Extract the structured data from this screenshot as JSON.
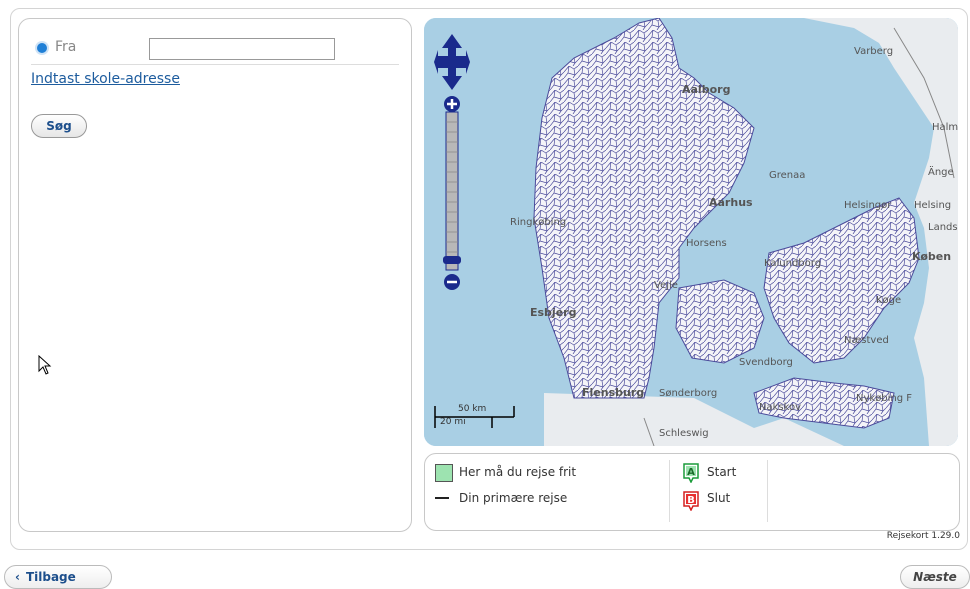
{
  "form": {
    "from_label": "Fra",
    "from_value": "",
    "school_link": "Indtast skole-adresse",
    "search_button": "Søg"
  },
  "map": {
    "labels": {
      "varberg": "Varberg",
      "aalborg": "Aalborg",
      "halmstad": "Halm",
      "grenaa": "Grenaa",
      "angelholm": "Änge",
      "aarhus": "Aarhus",
      "helsingor": "Helsingør",
      "helsingborg": "Helsing",
      "landskrona": "Lands",
      "ringkobing": "Ringkøbing",
      "horsens": "Horsens",
      "kalundborg": "Kalundborg",
      "kobenhavn": "Køben",
      "koge": "Køge",
      "esbjerg": "Esbjerg",
      "vejle": "Vejle",
      "naestved": "Næstved",
      "svendborg": "Svendborg",
      "flensburg": "Flensburg",
      "sonderborg": "Sønderborg",
      "nakskov": "Nakskov",
      "nykobing": "Nykøbing F",
      "schleswig": "Schleswig"
    },
    "scale_km": "50 km",
    "scale_mi": "20 mi"
  },
  "legend": {
    "free_travel": "Her må du rejse frit",
    "primary_trip": "Din primære rejse",
    "start": "Start",
    "end": "Slut",
    "start_marker": "A",
    "end_marker": "B"
  },
  "version": "Rejsekort 1.29.0",
  "nav": {
    "back": "Tilbage",
    "back_icon": "‹",
    "next": "Næste"
  },
  "colors": {
    "link": "#1d5c9e",
    "radio": "#1f7fd6",
    "sea": "#a9cfe4",
    "land": "#e9ecef",
    "municipality_border": "#4a4a9a",
    "free_zone": "#9de3b0",
    "marker_start": "#1a9c3a",
    "marker_end": "#d42020"
  }
}
